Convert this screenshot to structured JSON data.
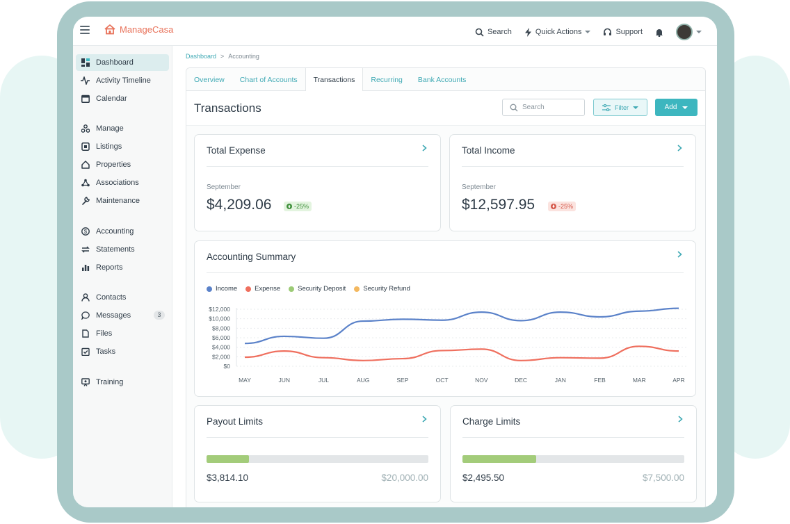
{
  "app": {
    "name": "ManageCasa",
    "brand_color": "#e8725a",
    "accent_color": "#3db6bf"
  },
  "topbar": {
    "search_label": "Search",
    "quick_actions_label": "Quick Actions",
    "support_label": "Support"
  },
  "sidebar": {
    "items": [
      {
        "label": "Dashboard",
        "icon": "dashboard-icon"
      },
      {
        "label": "Activity Timeline",
        "icon": "activity-icon"
      },
      {
        "label": "Calendar",
        "icon": "calendar-icon"
      },
      {
        "label": "Manage",
        "icon": "manage-icon"
      },
      {
        "label": "Listings",
        "icon": "listings-icon"
      },
      {
        "label": "Properties",
        "icon": "home-icon"
      },
      {
        "label": "Associations",
        "icon": "associations-icon"
      },
      {
        "label": "Maintenance",
        "icon": "wrench-icon"
      },
      {
        "label": "Accounting",
        "icon": "dollar-icon"
      },
      {
        "label": "Statements",
        "icon": "statements-icon"
      },
      {
        "label": "Reports",
        "icon": "reports-icon"
      },
      {
        "label": "Contacts",
        "icon": "person-icon"
      },
      {
        "label": "Messages",
        "icon": "chat-icon",
        "badge": "3"
      },
      {
        "label": "Files",
        "icon": "files-icon"
      },
      {
        "label": "Tasks",
        "icon": "tasks-icon"
      },
      {
        "label": "Training",
        "icon": "training-icon"
      }
    ]
  },
  "breadcrumb": {
    "root": "Dashboard",
    "separator": ">",
    "current": "Accounting"
  },
  "tabs": [
    "Overview",
    "Chart of Accounts",
    "Transactions",
    "Recurring",
    "Bank Accounts"
  ],
  "page": {
    "title": "Transactions",
    "search_placeholder": "Search",
    "filter_label": "Filter",
    "add_label": "Add"
  },
  "total_expense": {
    "title": "Total Expense",
    "period": "September",
    "amount": "$4,209.06",
    "delta": "-25%"
  },
  "total_income": {
    "title": "Total Income",
    "period": "September",
    "amount": "$12,597.95",
    "delta": "-25%"
  },
  "summary": {
    "title": "Accounting Summary"
  },
  "chart_data": {
    "type": "line",
    "title": "Accounting Summary",
    "categories": [
      "MAY",
      "JUN",
      "JUL",
      "AUG",
      "SEP",
      "OCT",
      "NOV",
      "DEC",
      "JAN",
      "FEB",
      "MAR",
      "APR"
    ],
    "series": [
      {
        "name": "Income",
        "color": "#5b82c9",
        "values": [
          4800,
          6300,
          5900,
          9500,
          9900,
          9700,
          11400,
          9600,
          11400,
          10400,
          11600,
          12200
        ]
      },
      {
        "name": "Expense",
        "color": "#ef6f5e",
        "values": [
          1900,
          3200,
          1800,
          1200,
          1600,
          3300,
          3600,
          1200,
          1800,
          1700,
          4200,
          3200
        ]
      },
      {
        "name": "Security Deposit",
        "color": "#9ccb76",
        "values": []
      },
      {
        "name": "Security Refund",
        "color": "#f3b860",
        "values": []
      }
    ],
    "yticks": [
      "$12,000",
      "$10,000",
      "$8,000",
      "$6,000",
      "$4,000",
      "$2,000",
      "$0"
    ],
    "ylim": [
      0,
      12000
    ],
    "grid": true,
    "legend": "top-left"
  },
  "payout_limits": {
    "title": "Payout Limits",
    "used": "$3,814.10",
    "max": "$20,000.00",
    "fraction": 0.1907
  },
  "charge_limits": {
    "title": "Charge Limits",
    "used": "$2,495.50",
    "max": "$7,500.00",
    "fraction": 0.3327
  }
}
